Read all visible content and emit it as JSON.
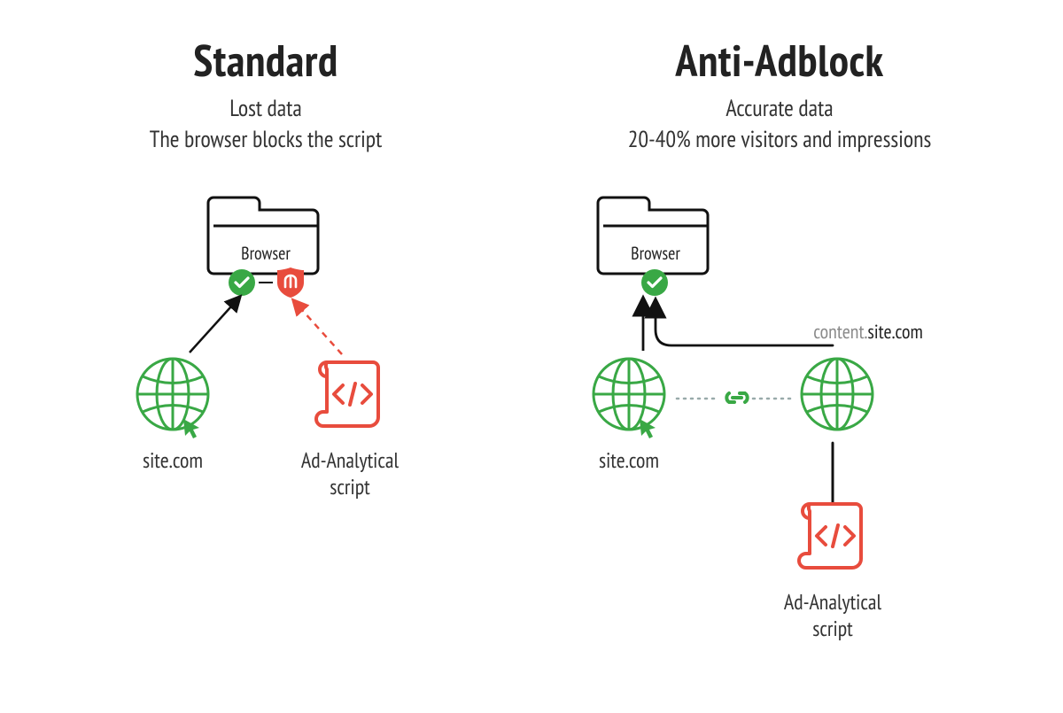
{
  "left": {
    "title": "Standard",
    "sub_line1": "Lost data",
    "sub_line2": "The browser blocks the script",
    "browser_label": "Browser",
    "site_label": "site.com",
    "script_label_line1": "Ad-Analytical",
    "script_label_line2": "script"
  },
  "right": {
    "title": "Anti-Adblock",
    "sub_line1": "Accurate data",
    "sub_line2": "20-40% more visitors and impressions",
    "browser_label": "Browser",
    "site_label": "site.com",
    "subdomain_muted": "content.",
    "subdomain_bold": "site.com",
    "script_label_line1": "Ad-Analytical",
    "script_label_line2": "script"
  },
  "colors": {
    "green": "#39a845",
    "red": "#e53e3e",
    "black": "#111111",
    "grey": "#888888"
  },
  "icons": {
    "browser": "folder-icon",
    "allow": "check-shield-icon",
    "block": "stop-shield-icon",
    "globe": "globe-icon",
    "script": "script-code-icon",
    "link": "chain-link-icon"
  }
}
